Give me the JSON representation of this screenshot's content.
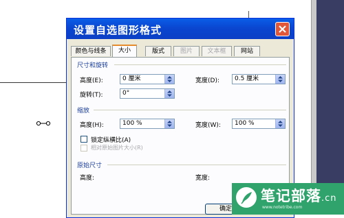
{
  "dialog": {
    "title": "设置自选图形格式",
    "tabs": [
      {
        "label": "颜色与线条",
        "state": "normal"
      },
      {
        "label": "大小",
        "state": "active"
      },
      {
        "label": "版式",
        "state": "normal"
      },
      {
        "label": "图片",
        "state": "disabled"
      },
      {
        "label": "文本框",
        "state": "disabled"
      },
      {
        "label": "网站",
        "state": "normal"
      }
    ],
    "size_rotate": {
      "section_label": "尺寸和旋转",
      "height_label": "高度(E):",
      "height_value": "0 厘米",
      "width_label": "宽度(D):",
      "width_value": "0.5 厘米",
      "rotate_label": "旋转(T):",
      "rotate_value": "0°"
    },
    "scale": {
      "section_label": "缩放",
      "height_label": "高度(H):",
      "height_value": "100 %",
      "width_label": "宽度(W):",
      "width_value": "100 %",
      "lock_label": "锁定纵横比(A)",
      "lock_checked": false,
      "relative_label": "相对原始图片大小(R)",
      "relative_enabled": false
    },
    "original": {
      "section_label": "原始尺寸",
      "height_label": "高度:",
      "width_label": "宽度:"
    },
    "ok_label": "确定"
  },
  "watermark": {
    "text": "笔记部落",
    "suffix": ".cn",
    "url": "www.notetribe.com"
  },
  "colors": {
    "titlebar": "#0a46d0",
    "close": "#e0573a",
    "section_text": "#1c3f9a",
    "watermark": "#2fa36b"
  }
}
